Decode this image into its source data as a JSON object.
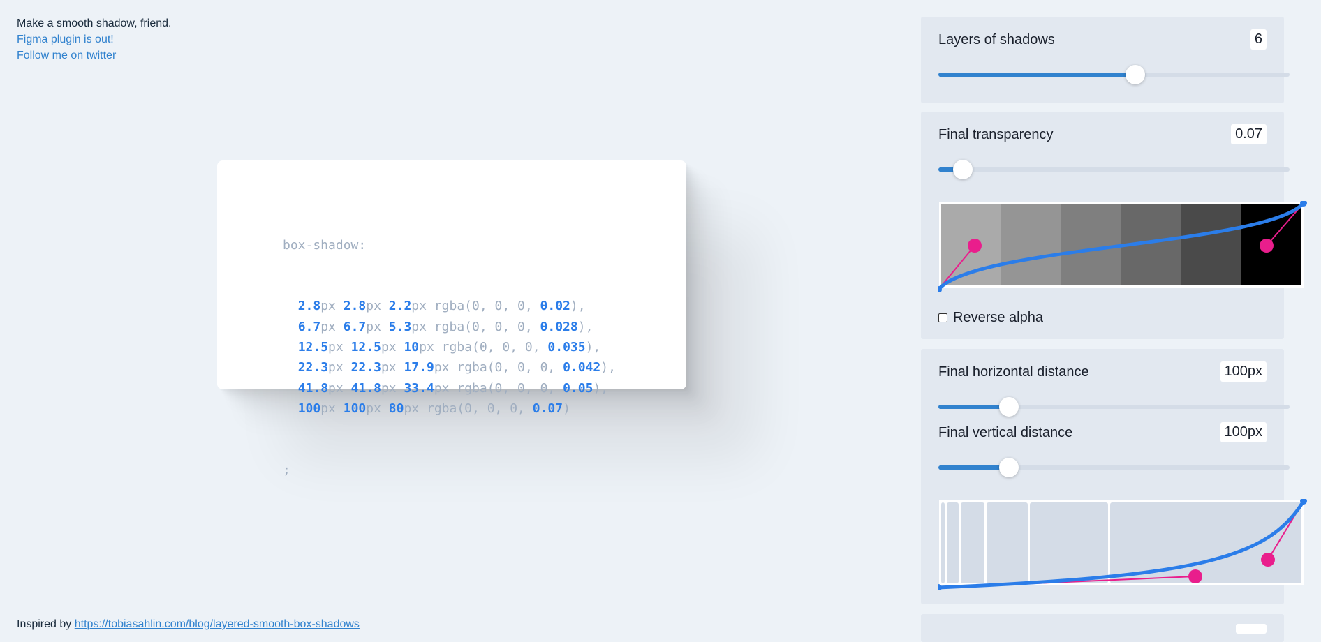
{
  "intro": {
    "tagline": "Make a smooth shadow, friend.",
    "figma_link": "Figma plugin is out!",
    "twitter_link": "Follow me on twitter"
  },
  "footer": {
    "prefix": "Inspired by",
    "link": "https://tobiasahlin.com/blog/layered-smooth-box-shadows"
  },
  "code": {
    "property": "box-shadow:",
    "layers": [
      {
        "x": "2.8",
        "y": "2.8",
        "blur": "2.2",
        "alpha": "0.02",
        "end": "),"
      },
      {
        "x": "6.7",
        "y": "6.7",
        "blur": "5.3",
        "alpha": "0.028",
        "end": "),"
      },
      {
        "x": "12.5",
        "y": "12.5",
        "blur": "10",
        "alpha": "0.035",
        "end": "),"
      },
      {
        "x": "22.3",
        "y": "22.3",
        "blur": "17.9",
        "alpha": "0.042",
        "end": "),"
      },
      {
        "x": "41.8",
        "y": "41.8",
        "blur": "33.4",
        "alpha": "0.05",
        "end": "),"
      },
      {
        "x": "100",
        "y": "100",
        "blur": "80",
        "alpha": "0.07",
        "end": ")"
      }
    ],
    "unit": "px",
    "rgba_prefix": "rgba(0, 0, 0, ",
    "terminator": ";"
  },
  "controls": {
    "layers": {
      "label": "Layers of shadows",
      "value": "6",
      "fraction": 0.56
    },
    "transparency": {
      "label": "Final transparency",
      "value": "0.07",
      "fraction": 0.07
    },
    "reverse_alpha": {
      "label": "Reverse alpha",
      "checked": false
    },
    "horizontal": {
      "label": "Final horizontal distance",
      "value": "100px",
      "fraction": 0.2
    },
    "vertical": {
      "label": "Final vertical distance",
      "value": "100px",
      "fraction": 0.2
    }
  },
  "colors": {
    "accent": "#3182ce",
    "curve": "#2b7de9",
    "handle": "#e91e8c",
    "panel": "#e2e8f0",
    "background": "#edf2f7"
  },
  "swatches": [
    "#aaaaaa",
    "#959595",
    "#7f7f7f",
    "#686868",
    "#4a4a4a",
    "#000000"
  ]
}
